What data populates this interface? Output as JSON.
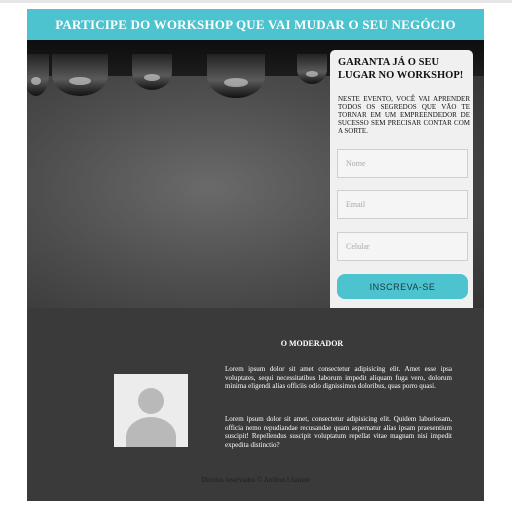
{
  "banner": {
    "title": "PARTICIPE DO WORKSHOP QUE VAI MUDAR O SEU NEGÓCIO"
  },
  "form": {
    "title": "GARANTA JÁ O SEU LUGAR NO WORKSHOP!",
    "description": "NESTE EVENTO, VOCÊ VAI APRENDER TODOS OS SEGREDOS QUE VÃO TE TORNAR EM UM EMPREENDEDOR DE SUCESSO SEM PRECISAR CONTAR COM A SORTE.",
    "name_placeholder": "Nome",
    "email_placeholder": "Email",
    "phone_placeholder": "Celular",
    "submit_label": "INSCREVA-SE"
  },
  "moderator": {
    "title": "O MODERADOR",
    "bio_1": "Lorem ipsum dolor sit amet consectetur adipisicing elit. Amet esse ipsa voluptates, sequi necessitatibus laborum impedit aliquam fuga vero, dolorum minima eligendi alias officiis odio dignissimos doloribus, quas porro quasi.",
    "bio_2": "Lorem ipsum dolor sit amet, consectetur adipisicing elit. Quidem laboriosam, officia nemo repudiandae recusandae quam aspernatur alias ipsam praesentium suscipit! Repellendus suscipit voluptatum repellat vitae magnam nisi impedit expedita distinctio?"
  },
  "footer": {
    "text": "Direitos reservados © Anilton Lhanine"
  },
  "colors": {
    "accent": "#4cc3cf",
    "page_bg": "#3a3a3a",
    "card_bg": "#f0f0f0"
  }
}
